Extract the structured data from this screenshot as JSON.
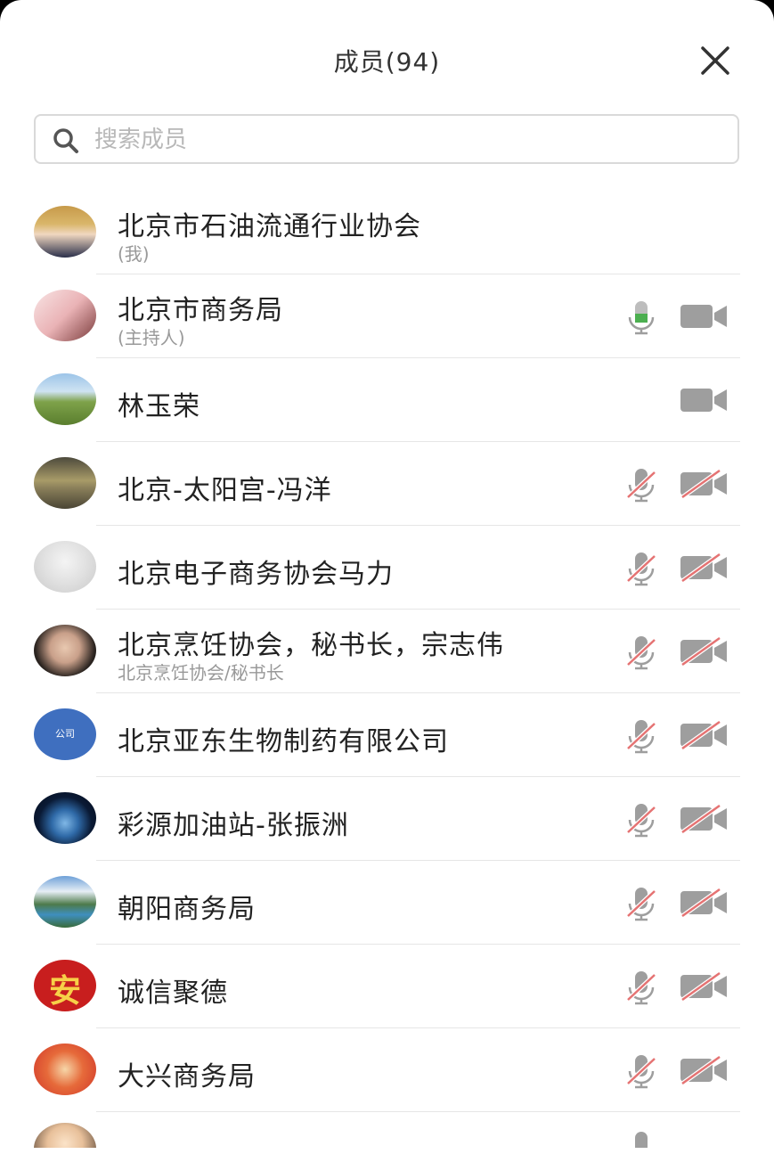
{
  "title": "成员(94)",
  "search": {
    "placeholder": "搜索成员",
    "value": ""
  },
  "colors": {
    "mic_active": "#4caf50",
    "muted_slash": "#e57373",
    "icon_gray": "#9e9e9e"
  },
  "members": [
    {
      "name": "北京市石油流通行业协会",
      "sub": "(我)",
      "avatar": "photo-woman-portrait",
      "mic": "none",
      "cam": "none"
    },
    {
      "name": "北京市商务局",
      "sub": "(主持人)",
      "avatar": "illustrated-girl",
      "mic": "on",
      "cam": "on"
    },
    {
      "name": "林玉荣",
      "sub": "",
      "avatar": "field-landscape",
      "mic": "none",
      "cam": "on"
    },
    {
      "name": "北京-太阳宫-冯洋",
      "sub": "",
      "avatar": "blurred-plate",
      "mic": "off",
      "cam": "off"
    },
    {
      "name": "北京电子商务协会马力",
      "sub": "",
      "avatar": "woman-portrait-light",
      "mic": "off",
      "cam": "off"
    },
    {
      "name": "北京烹饪协会，秘书长，宗志伟",
      "sub": "北京烹饪协会/秘书长",
      "avatar": "woman-selfie",
      "mic": "off",
      "cam": "off"
    },
    {
      "name": "北京亚东生物制药有限公司",
      "sub": "",
      "avatar": "blue-badge",
      "avatar_text": "公司",
      "mic": "off",
      "cam": "off"
    },
    {
      "name": "彩源加油站-张振洲",
      "sub": "",
      "avatar": "earth-space",
      "mic": "off",
      "cam": "off"
    },
    {
      "name": "朝阳商务局",
      "sub": "",
      "avatar": "mountain-lake",
      "mic": "off",
      "cam": "off"
    },
    {
      "name": "诚信聚德",
      "sub": "",
      "avatar": "red-character",
      "avatar_text": "安",
      "mic": "off",
      "cam": "off"
    },
    {
      "name": "大兴商务局",
      "sub": "",
      "avatar": "red-cartoon",
      "mic": "off",
      "cam": "off"
    }
  ]
}
